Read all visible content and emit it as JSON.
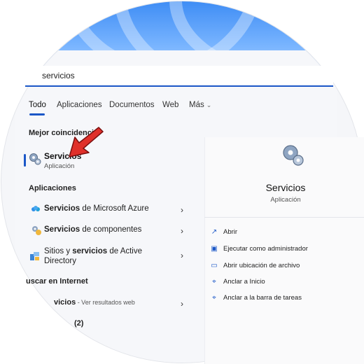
{
  "search": {
    "value": "servicios"
  },
  "tabs": [
    "Todo",
    "Aplicaciones",
    "Documentos",
    "Web",
    "Más"
  ],
  "sections": {
    "best_match": "Mejor coincidencia",
    "apps": "Aplicaciones",
    "web": "uscar en Internet",
    "more": "(2)"
  },
  "best_match": {
    "title": "Servicios",
    "subtitle": "Aplicación",
    "icon": "gears-icon"
  },
  "apps": [
    {
      "bold": "Servicios",
      "rest": " de Microsoft Azure",
      "icon": "azure-icon"
    },
    {
      "bold": "Servicios",
      "rest": " de componentes",
      "icon": "component-services-icon"
    },
    {
      "pre": "Sitios y ",
      "bold": "servicios",
      "rest": " de Active",
      "line2": "Directory",
      "icon": "active-directory-icon"
    }
  ],
  "web_result": {
    "bold": "vicios",
    "rest": " - Ver resultados web"
  },
  "detail": {
    "title": "Servicios",
    "subtitle": "Aplicación",
    "actions": [
      {
        "label": "Abrir",
        "icon": "open-external-icon"
      },
      {
        "label": "Ejecutar como administrador",
        "icon": "shield-icon"
      },
      {
        "label": "Abrir ubicación de archivo",
        "icon": "folder-icon"
      },
      {
        "label": "Anclar a Inicio",
        "icon": "pin-icon"
      },
      {
        "label": "Anclar a la barra de tareas",
        "icon": "pin-icon"
      }
    ]
  },
  "colors": {
    "accent": "#1b57c7",
    "arrow": "#e0302a"
  }
}
